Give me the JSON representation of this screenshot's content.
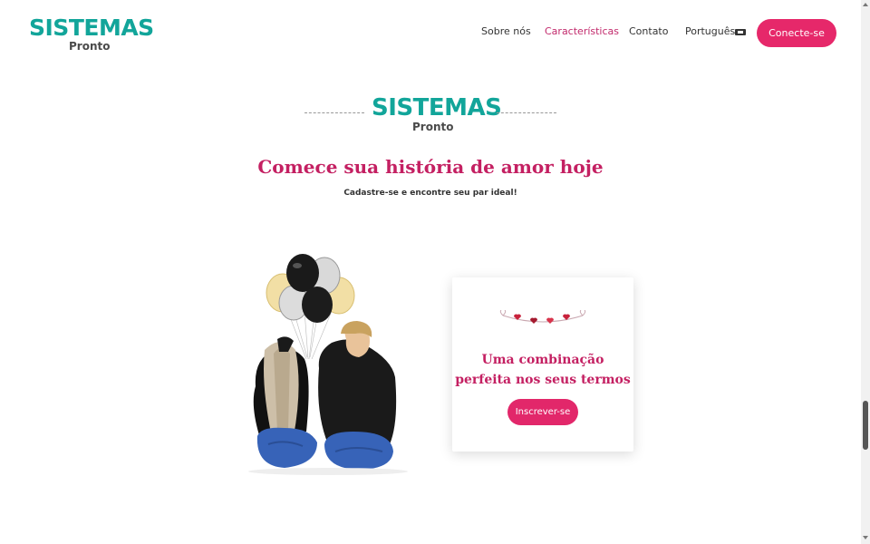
{
  "header": {
    "logo_main": "SISTEMAS",
    "logo_sub": "Pronto",
    "nav": [
      {
        "label": "Sobre nós"
      },
      {
        "label": "Características"
      },
      {
        "label": "Contato"
      },
      {
        "label": "Português"
      }
    ],
    "connect_label": "Conecte-se"
  },
  "hero": {
    "logo_main": "SISTEMAS",
    "logo_sub": "Pronto",
    "headline": "Comece sua história de amor hoje",
    "subline": "Cadastre-se e encontre seu par ideal!"
  },
  "card": {
    "title_line1": "Uma combinação",
    "title_line2": "perfeita nos seus termos",
    "button_label": "Inscrever-se"
  },
  "icons": {
    "flag": "uk-flag-icon",
    "garland": "heart-garland-icon"
  },
  "colors": {
    "brand_teal": "#12a59a",
    "accent_pink": "#e6286a",
    "headline_crimson": "#c42062",
    "active_nav": "#c22a6c"
  }
}
